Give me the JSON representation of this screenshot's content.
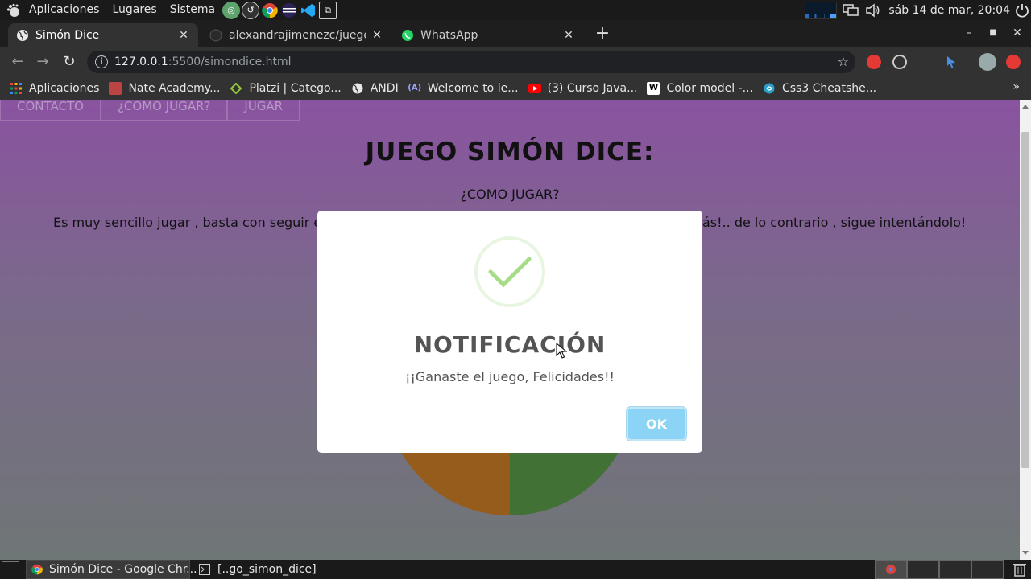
{
  "top_panel": {
    "menus": [
      "Aplicaciones",
      "Lugares",
      "Sistema"
    ],
    "clock": "sáb 14 de mar, 20:04"
  },
  "tabs": [
    {
      "label": "Simón Dice",
      "active": true
    },
    {
      "label": "alexandrajimenezc/juego",
      "active": false
    },
    {
      "label": "WhatsApp",
      "active": false
    }
  ],
  "omnibox": {
    "host": "127.0.0.1",
    "path": ":5500/simondice.html"
  },
  "bookmarks": [
    {
      "label": "Aplicaciones",
      "icon": "apps-grid-icon"
    },
    {
      "label": "Nate Academy...",
      "icon": "avatar-icon"
    },
    {
      "label": "Platzi | Catego...",
      "icon": "platzi-icon"
    },
    {
      "label": "ANDI",
      "icon": "globe-icon"
    },
    {
      "label": "Welcome to le...",
      "icon": "a-logo-icon"
    },
    {
      "label": "(3) Curso Java...",
      "icon": "youtube-icon"
    },
    {
      "label": "Color model -...",
      "icon": "wikipedia-icon"
    },
    {
      "label": "Css3 Cheatshe...",
      "icon": "cheatsheet-icon"
    }
  ],
  "page": {
    "nav": [
      "CONTACTO",
      "¿COMO JUGAR?",
      "JUGAR"
    ],
    "title": "JUEGO SIMÓN DICE:",
    "howto": "¿COMO JUGAR?",
    "desc_left": "Es muy sencillo jugar , basta con seguir e",
    "desc_right": "ás!.. de lo contrario , sigue intentándolo!"
  },
  "modal": {
    "title": "NOTIFICACIÓN",
    "text": "¡¡Ganaste el juego, Felicidades!!",
    "ok_label": "OK"
  },
  "taskbar": [
    {
      "label": "Simón Dice - Google Chr...",
      "active": true
    },
    {
      "label": "[..go_simon_dice]",
      "active": false
    }
  ],
  "colors": {
    "simon_orange": "#955c1c",
    "simon_green": "#417134",
    "ok_button": "#8cd4f5",
    "check_green": "#a5dc86"
  }
}
